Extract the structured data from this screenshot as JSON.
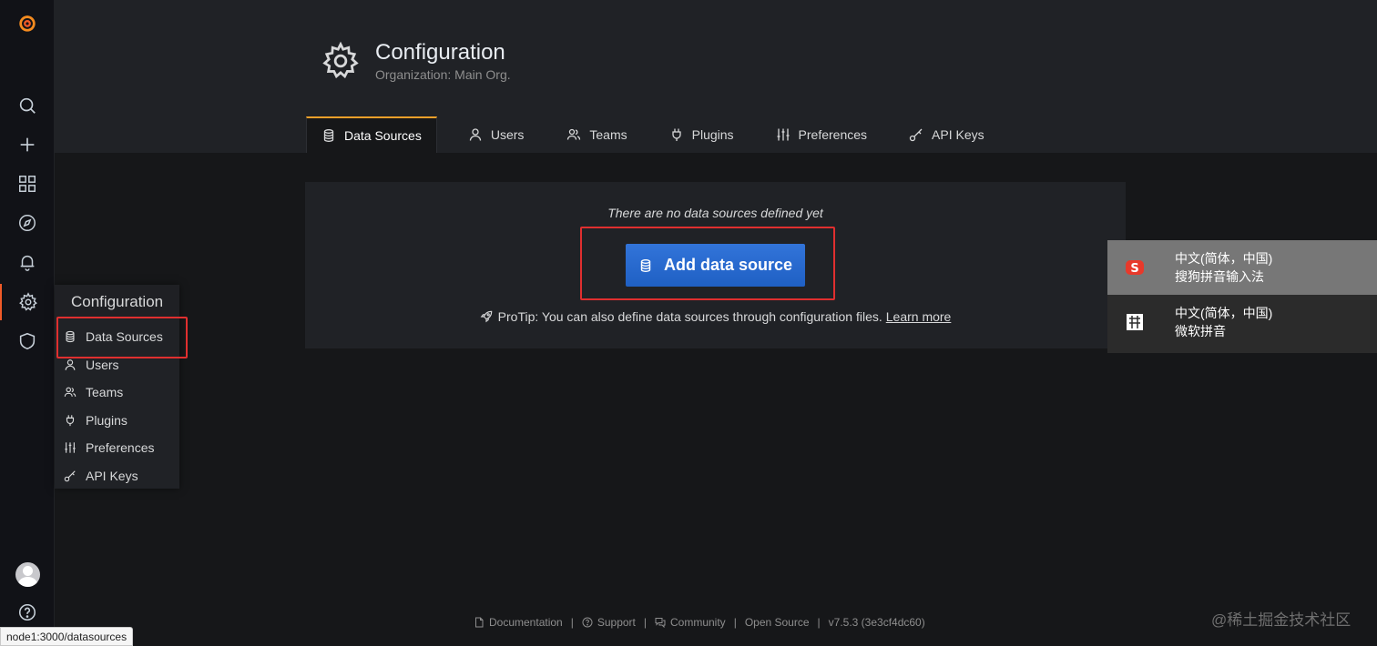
{
  "sidebar": {
    "logo_icon": "grafana-logo-icon",
    "items": [
      {
        "name": "search",
        "icon": "search-icon"
      },
      {
        "name": "create",
        "icon": "plus-icon"
      },
      {
        "name": "dashboards",
        "icon": "dashboards-grid-icon"
      },
      {
        "name": "explore",
        "icon": "compass-icon"
      },
      {
        "name": "alerting",
        "icon": "bell-icon"
      },
      {
        "name": "configuration",
        "icon": "gear-icon",
        "active": true
      },
      {
        "name": "server-admin",
        "icon": "shield-icon"
      }
    ],
    "bottom": [
      {
        "name": "profile",
        "icon": "avatar"
      },
      {
        "name": "help",
        "icon": "help-icon"
      }
    ]
  },
  "flyout": {
    "title": "Configuration",
    "items": [
      {
        "label": "Data Sources",
        "icon": "database-icon"
      },
      {
        "label": "Users",
        "icon": "user-icon"
      },
      {
        "label": "Teams",
        "icon": "users-icon"
      },
      {
        "label": "Plugins",
        "icon": "plug-icon"
      },
      {
        "label": "Preferences",
        "icon": "sliders-icon"
      },
      {
        "label": "API Keys",
        "icon": "key-icon"
      }
    ]
  },
  "header": {
    "title": "Configuration",
    "subtitle": "Organization: Main Org.",
    "tabs": [
      {
        "label": "Data Sources",
        "icon": "database-icon",
        "active": true
      },
      {
        "label": "Users",
        "icon": "user-icon"
      },
      {
        "label": "Teams",
        "icon": "users-icon"
      },
      {
        "label": "Plugins",
        "icon": "plug-icon"
      },
      {
        "label": "Preferences",
        "icon": "sliders-icon"
      },
      {
        "label": "API Keys",
        "icon": "key-icon"
      }
    ]
  },
  "empty_state": {
    "message": "There are no data sources defined yet",
    "button_label": "Add data source",
    "protip_text": "ProTip: You can also define data sources through configuration files.",
    "protip_link": "Learn more"
  },
  "ime": {
    "items": [
      {
        "line1": "中文(简体，中国)",
        "line2": "搜狗拼音输入法",
        "selected": true
      },
      {
        "line1": "中文(简体，中国)",
        "line2": "微软拼音",
        "selected": false
      }
    ]
  },
  "footer": {
    "links": [
      "Documentation",
      "Support",
      "Community",
      "Open Source"
    ],
    "version": "v7.5.3 (3e3cf4dc60)"
  },
  "watermark": "@稀土掘金技术社区",
  "status_url": "node1:3000/datasources",
  "colors": {
    "accent": "#f05a28",
    "tab_active_border": "#f4a02a",
    "primary_button": "#3274d9",
    "highlight_box": "#e02f2f"
  }
}
